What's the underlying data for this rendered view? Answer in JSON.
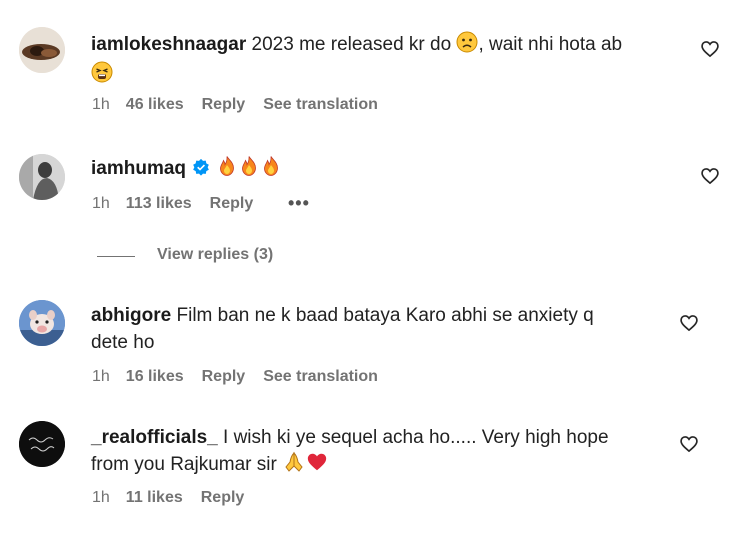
{
  "comments": [
    {
      "username": "iamlokeshnaagar",
      "text_part1": " 2023 me released kr do ",
      "text_part2": ", wait nhi hota ab",
      "time": "1h",
      "likes": "46 likes",
      "reply": "Reply",
      "translation": "See translation",
      "avatar_icon": "profile-photo"
    },
    {
      "username": "iamhumaq",
      "verified": true,
      "text": "",
      "time": "1h",
      "likes": "113 likes",
      "reply": "Reply",
      "more": "•••",
      "view_replies": "View replies (3)",
      "avatar_icon": "profile-photo"
    },
    {
      "username": "abhigore",
      "text_line1": " Film ban ne k baad bataya Karo abhi se anxiety q",
      "text_line2": "dete ho",
      "time": "1h",
      "likes": "16 likes",
      "reply": "Reply",
      "translation": "See translation",
      "avatar_icon": "profile-photo"
    },
    {
      "username": "_realofficials_",
      "text_line1": " I wish ki ye sequel acha ho..... Very high hope",
      "text_line2": "from you Rajkumar sir ",
      "time": "1h",
      "likes": "11 likes",
      "reply": "Reply",
      "avatar_icon": "profile-photo"
    }
  ],
  "colors": {
    "text": "#1b1b1b",
    "secondary": "#737373",
    "verified_blue": "#0095f6",
    "heart_red": "#ed4956"
  },
  "icons": [
    "heart-outline-icon",
    "verified-badge-icon",
    "fire-emoji",
    "sad-face-emoji",
    "tired-face-emoji",
    "praying-hands-emoji",
    "red-heart-emoji"
  ]
}
